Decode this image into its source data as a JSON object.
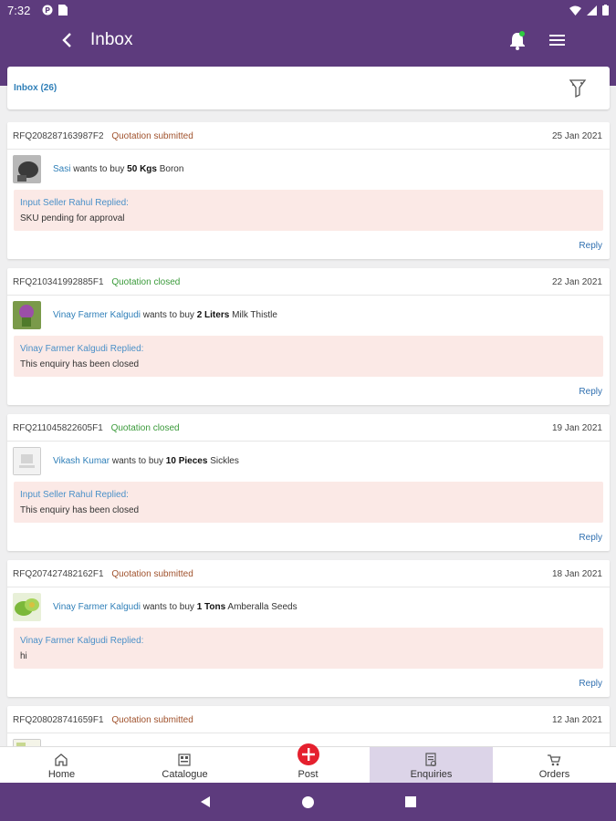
{
  "status_bar": {
    "time": "7:32"
  },
  "app_bar": {
    "title": "Inbox"
  },
  "inbox": {
    "label": "Inbox (26)"
  },
  "enquiries": [
    {
      "rfq": "RFQ208287163987F2",
      "status": "Quotation submitted",
      "status_kind": "submitted",
      "date": "25 Jan 2021",
      "buyer": "Sasi",
      "wants": "wants to buy",
      "qty": "50 Kgs",
      "product": "Boron",
      "replier": "Input Seller Rahul Replied:",
      "reply": "SKU pending for approval",
      "reply_label": "Reply"
    },
    {
      "rfq": "RFQ210341992885F1",
      "status": "Quotation closed",
      "status_kind": "closed",
      "date": "22 Jan 2021",
      "buyer": "Vinay Farmer Kalgudi",
      "wants": "wants to buy",
      "qty": "2 Liters",
      "product": "Milk Thistle",
      "replier": "Vinay Farmer Kalgudi Replied:",
      "reply": "This enquiry has been closed",
      "reply_label": "Reply"
    },
    {
      "rfq": "RFQ211045822605F1",
      "status": "Quotation closed",
      "status_kind": "closed",
      "date": "19 Jan 2021",
      "buyer": "Vikash Kumar",
      "wants": "wants to buy",
      "qty": "10 Pieces",
      "product": "Sickles",
      "replier": "Input Seller Rahul Replied:",
      "reply": "This enquiry has been closed",
      "reply_label": "Reply"
    },
    {
      "rfq": "RFQ207427482162F1",
      "status": "Quotation submitted",
      "status_kind": "submitted",
      "date": "18 Jan 2021",
      "buyer": "Vinay Farmer Kalgudi",
      "wants": "wants to buy",
      "qty": "1 Tons",
      "product": "Amberalla Seeds",
      "replier": "Vinay Farmer Kalgudi Replied:",
      "reply": "hi",
      "reply_label": "Reply"
    },
    {
      "rfq": "RFQ208028741659F1",
      "status": "Quotation submitted",
      "status_kind": "submitted",
      "date": "12 Jan 2021",
      "buyer": "",
      "wants": "",
      "qty": "",
      "product": "",
      "replier": "",
      "reply": "",
      "reply_label": ""
    }
  ],
  "bottom_nav": [
    {
      "label": "Home",
      "icon": "home-icon"
    },
    {
      "label": "Catalogue",
      "icon": "catalogue-icon"
    },
    {
      "label": "Post",
      "icon": "add-circle-icon"
    },
    {
      "label": "Enquiries",
      "icon": "enquiries-icon",
      "active": true
    },
    {
      "label": "Orders",
      "icon": "cart-icon"
    }
  ],
  "colors": {
    "primary": "#5d3b7d",
    "accent_red": "#e5202e",
    "link_blue": "#2f7fb8"
  }
}
